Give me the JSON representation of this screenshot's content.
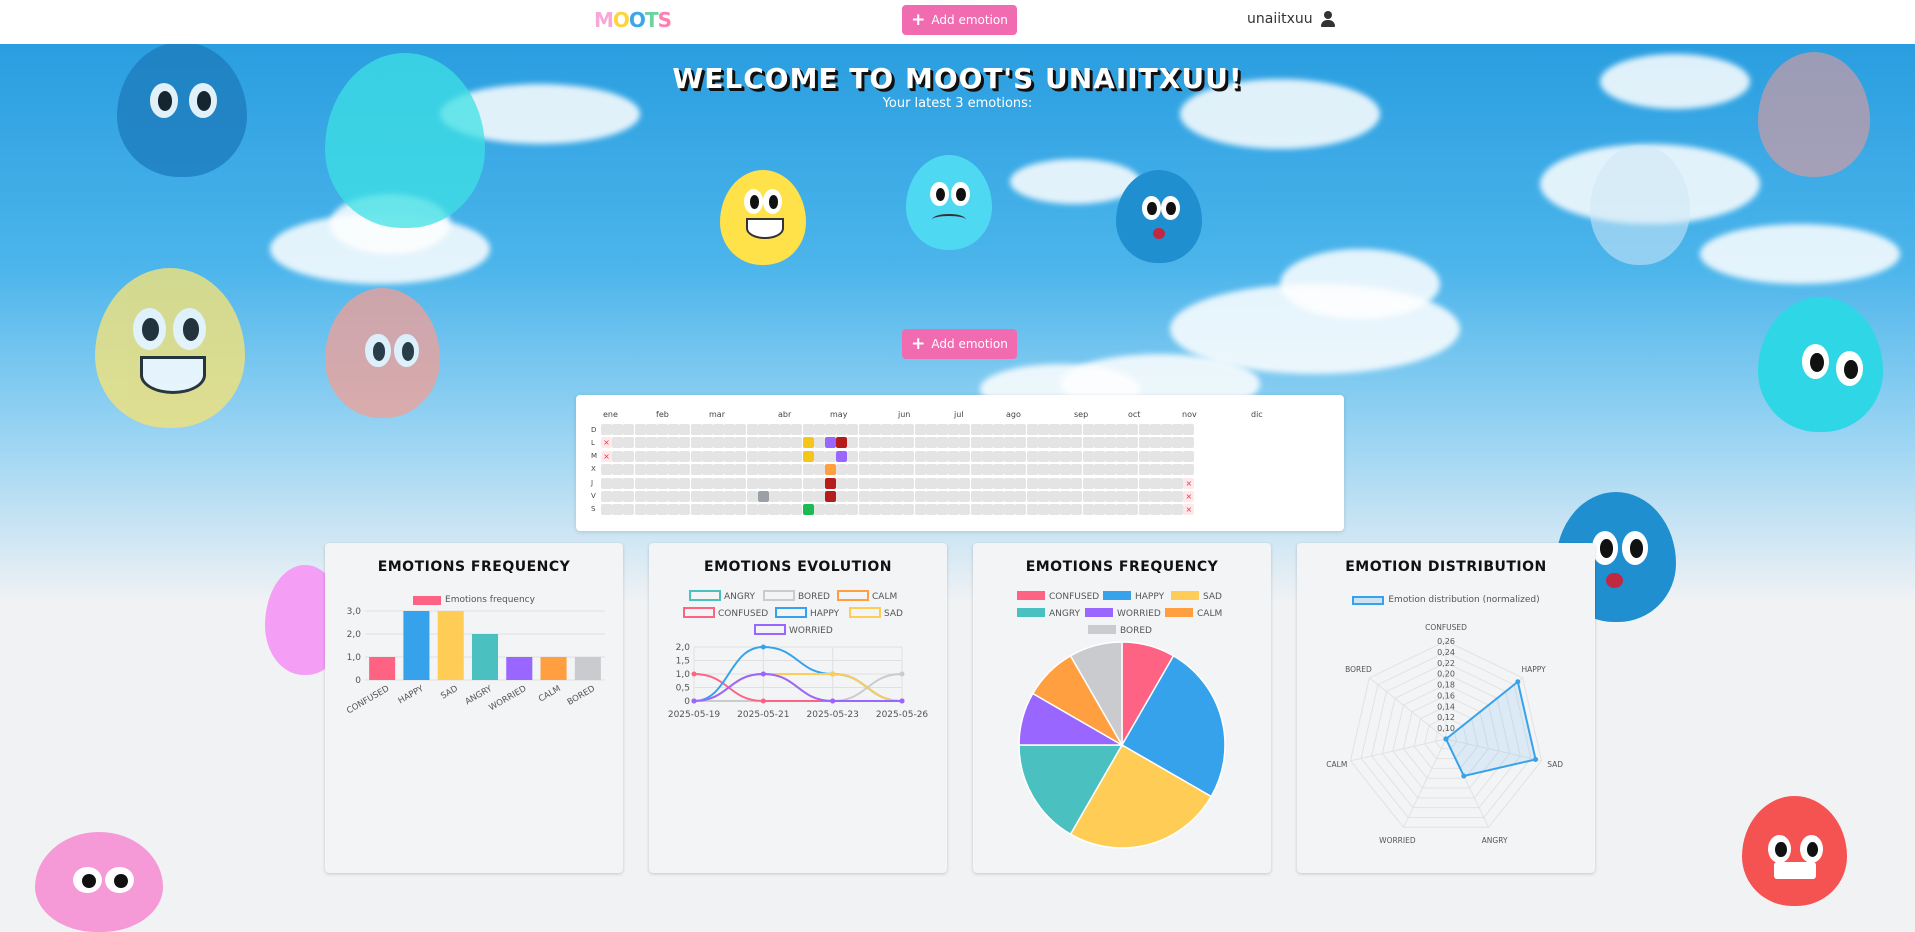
{
  "navbar": {
    "logo": "MOOTS",
    "add_emotion_label": "Add emotion",
    "username": "unaiitxuu"
  },
  "hero": {
    "title": "WELCOME TO MOOT'S UNAIITXUU!",
    "subtitle": "Your latest 3 emotions:",
    "add_emotion_label": "Add emotion"
  },
  "calendar": {
    "months": [
      "ene",
      "feb",
      "mar",
      "abr",
      "may",
      "jun",
      "jul",
      "ago",
      "sep",
      "oct",
      "nov",
      "dic"
    ],
    "days": [
      "D",
      "L",
      "M",
      "X",
      "J",
      "V",
      "S"
    ]
  },
  "colors": {
    "confused": "#ff6384",
    "happy": "#36a2eb",
    "sad": "#ffcd56",
    "angry": "#4bc0c0",
    "worried": "#9966ff",
    "calm": "#ff9f40",
    "bored": "#c9cbcf",
    "accent": "#f06bb0"
  },
  "cards": {
    "freq_bar": {
      "title": "EMOTIONS FREQUENCY",
      "legend": "Emotions frequency"
    },
    "evolution": {
      "title": "EMOTIONS EVOLUTION"
    },
    "freq_pie": {
      "title": "EMOTIONS FREQUENCY"
    },
    "distribution": {
      "title": "EMOTION DISTRIBUTION",
      "legend": "Emotion distribution (normalized)"
    }
  },
  "chart_data": [
    {
      "type": "bar",
      "title": "EMOTIONS FREQUENCY",
      "categories": [
        "CONFUSED",
        "HAPPY",
        "SAD",
        "ANGRY",
        "WORRIED",
        "CALM",
        "BORED"
      ],
      "series": [
        {
          "name": "Emotions frequency",
          "values": [
            1,
            3,
            3,
            2,
            1,
            1,
            1
          ]
        }
      ],
      "yticks": [
        "0",
        "1,0",
        "2,0",
        "3,0"
      ],
      "ylim": [
        0,
        3
      ]
    },
    {
      "type": "line",
      "title": "EMOTIONS EVOLUTION",
      "x": [
        "2025-05-19",
        "2025-05-21",
        "2025-05-23",
        "2025-05-26"
      ],
      "yticks": [
        "0",
        "0,5",
        "1,0",
        "1,5",
        "2,0"
      ],
      "ylim": [
        0,
        2
      ],
      "series": [
        {
          "name": "ANGRY",
          "values": [
            0,
            1,
            1,
            0
          ]
        },
        {
          "name": "BORED",
          "values": [
            0,
            0,
            0,
            1
          ]
        },
        {
          "name": "CALM",
          "values": [
            0,
            1,
            0,
            0
          ]
        },
        {
          "name": "CONFUSED",
          "values": [
            1,
            0,
            0,
            0
          ]
        },
        {
          "name": "HAPPY",
          "values": [
            0,
            2,
            1,
            0
          ]
        },
        {
          "name": "SAD",
          "values": [
            0,
            1,
            1,
            0
          ]
        },
        {
          "name": "WORRIED",
          "values": [
            0,
            1,
            0,
            0
          ]
        }
      ]
    },
    {
      "type": "pie",
      "title": "EMOTIONS FREQUENCY",
      "categories": [
        "CONFUSED",
        "HAPPY",
        "SAD",
        "ANGRY",
        "WORRIED",
        "CALM",
        "BORED"
      ],
      "values": [
        1,
        3,
        3,
        2,
        1,
        1,
        1
      ]
    },
    {
      "type": "radar",
      "title": "EMOTION DISTRIBUTION",
      "categories": [
        "CONFUSED",
        "HAPPY",
        "SAD",
        "ANGRY",
        "WORRIED",
        "CALM",
        "BORED"
      ],
      "series": [
        {
          "name": "Emotion distribution (normalized)",
          "values": [
            0.083,
            0.25,
            0.25,
            0.167,
            0.083,
            0.083,
            0.083
          ]
        }
      ],
      "rticks": [
        "0,10",
        "0,12",
        "0,14",
        "0,16",
        "0,18",
        "0,20",
        "0,22",
        "0,24",
        "0,26"
      ],
      "rlim": [
        0.1,
        0.26
      ]
    }
  ]
}
